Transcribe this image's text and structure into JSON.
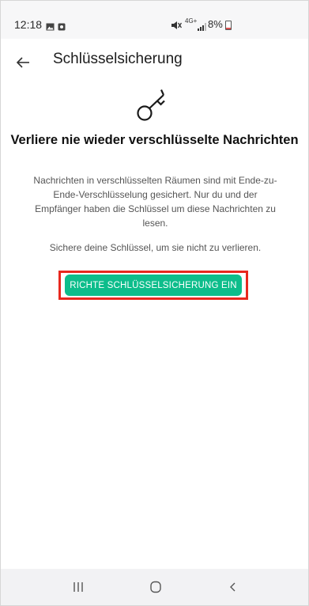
{
  "status_bar": {
    "time": "12:18",
    "network_label": "4G+",
    "battery_text": "8%",
    "battery_level": 0.08,
    "icons": [
      "gallery-icon",
      "notification-icon",
      "mute-icon",
      "signal-icon",
      "battery-icon"
    ]
  },
  "app_bar": {
    "back_icon": "arrow-left-icon",
    "title": "Schlüsselsicherung"
  },
  "content": {
    "icon": "key-icon",
    "headline": "Verliere nie wieder verschlüsselte Nachrichten",
    "description": "Nachrichten in verschlüsselten Räumen sind mit Ende-zu-Ende-Verschlüsselung gesichert. Nur du und der Empfänger haben die Schlüssel um diese Nachrichten zu lesen.",
    "hint": "Sichere deine Schlüssel, um sie nicht zu verlieren.",
    "setup_button_label": "RICHTE SCHLÜSSELSICHERUNG EIN"
  },
  "nav_bar": {
    "buttons": [
      "recent-apps-icon",
      "home-icon",
      "back-icon"
    ]
  },
  "colors": {
    "accent": "#0dbd8b",
    "highlight": "#e8281e",
    "status_bar_bg": "#f7f7f8",
    "nav_bar_bg": "#f2f2f4"
  }
}
